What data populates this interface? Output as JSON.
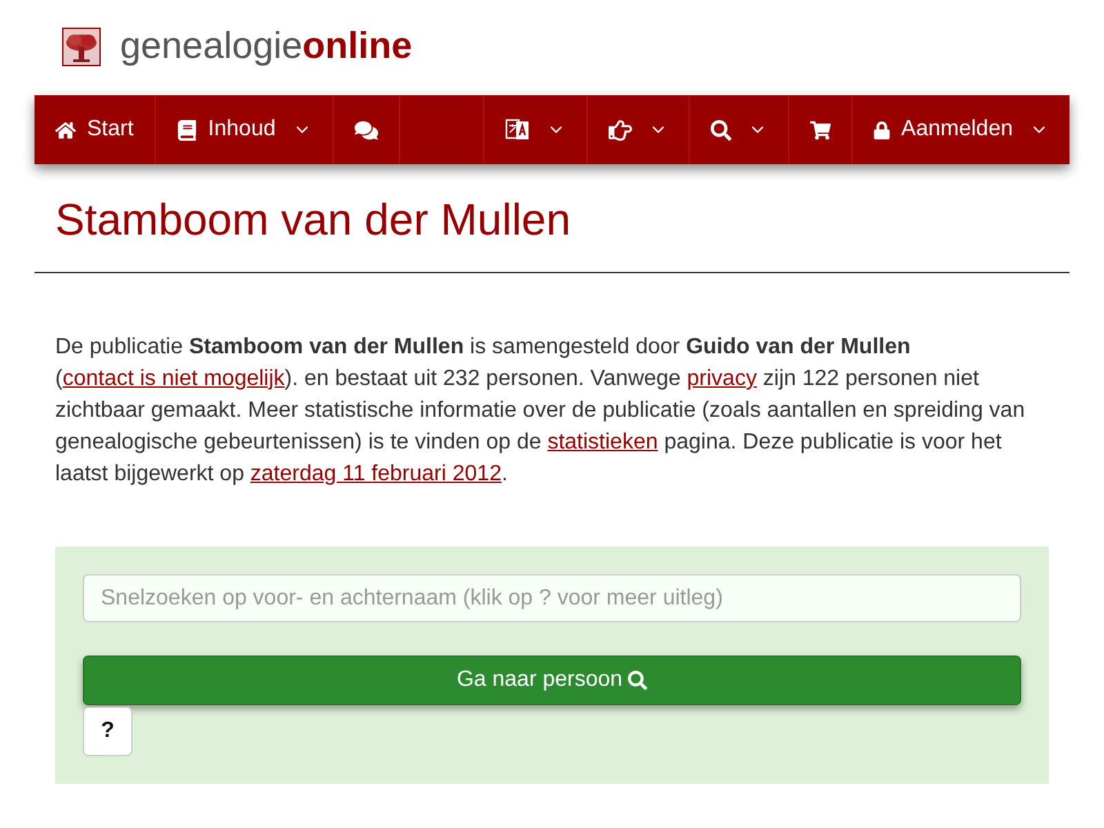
{
  "logo": {
    "text": "genealogie",
    "text_bold": "online"
  },
  "nav": {
    "left": [
      {
        "label": "Start",
        "dropdown": false
      },
      {
        "label": "Inhoud",
        "dropdown": true
      },
      {
        "dropdown": false
      }
    ],
    "right": [
      {
        "dropdown": true
      },
      {
        "dropdown": true
      },
      {
        "dropdown": true
      },
      {
        "dropdown": false
      },
      {
        "label": "Aanmelden",
        "dropdown": true
      }
    ]
  },
  "page_title": "Stamboom van der Mullen",
  "intro": [
    {
      "kind": "text",
      "text": "De publicatie **Stamboom van der Mullen** is samengesteld door **Guido van der Mullen** ("
    },
    {
      "kind": "link",
      "text": "contact is niet mogelijk"
    },
    {
      "kind": "text",
      "text": "). en bestaat uit 232 personen. Vanwege "
    },
    {
      "kind": "link",
      "text": "privacy"
    },
    {
      "kind": "text",
      "text": " zijn 122 personen niet zichtbaar gemaakt. Meer statistische informatie over de publicatie (zoals aantallen en spreiding van genealogische gebeurtenissen) is te vinden op de "
    },
    {
      "kind": "link",
      "text": "statistieken"
    },
    {
      "kind": "text",
      "text": " pagina. Deze publicatie is voor het laatst bijgewerkt op "
    },
    {
      "kind": "link",
      "text": "zaterdag 11 februari 2012"
    },
    {
      "kind": "text",
      "text": "."
    }
  ],
  "search": {
    "placeholder": "Snelzoeken op voor- en achternaam (klik op ? voor meer uitleg)",
    "button": "Ga naar persoon",
    "help_button": "?"
  }
}
